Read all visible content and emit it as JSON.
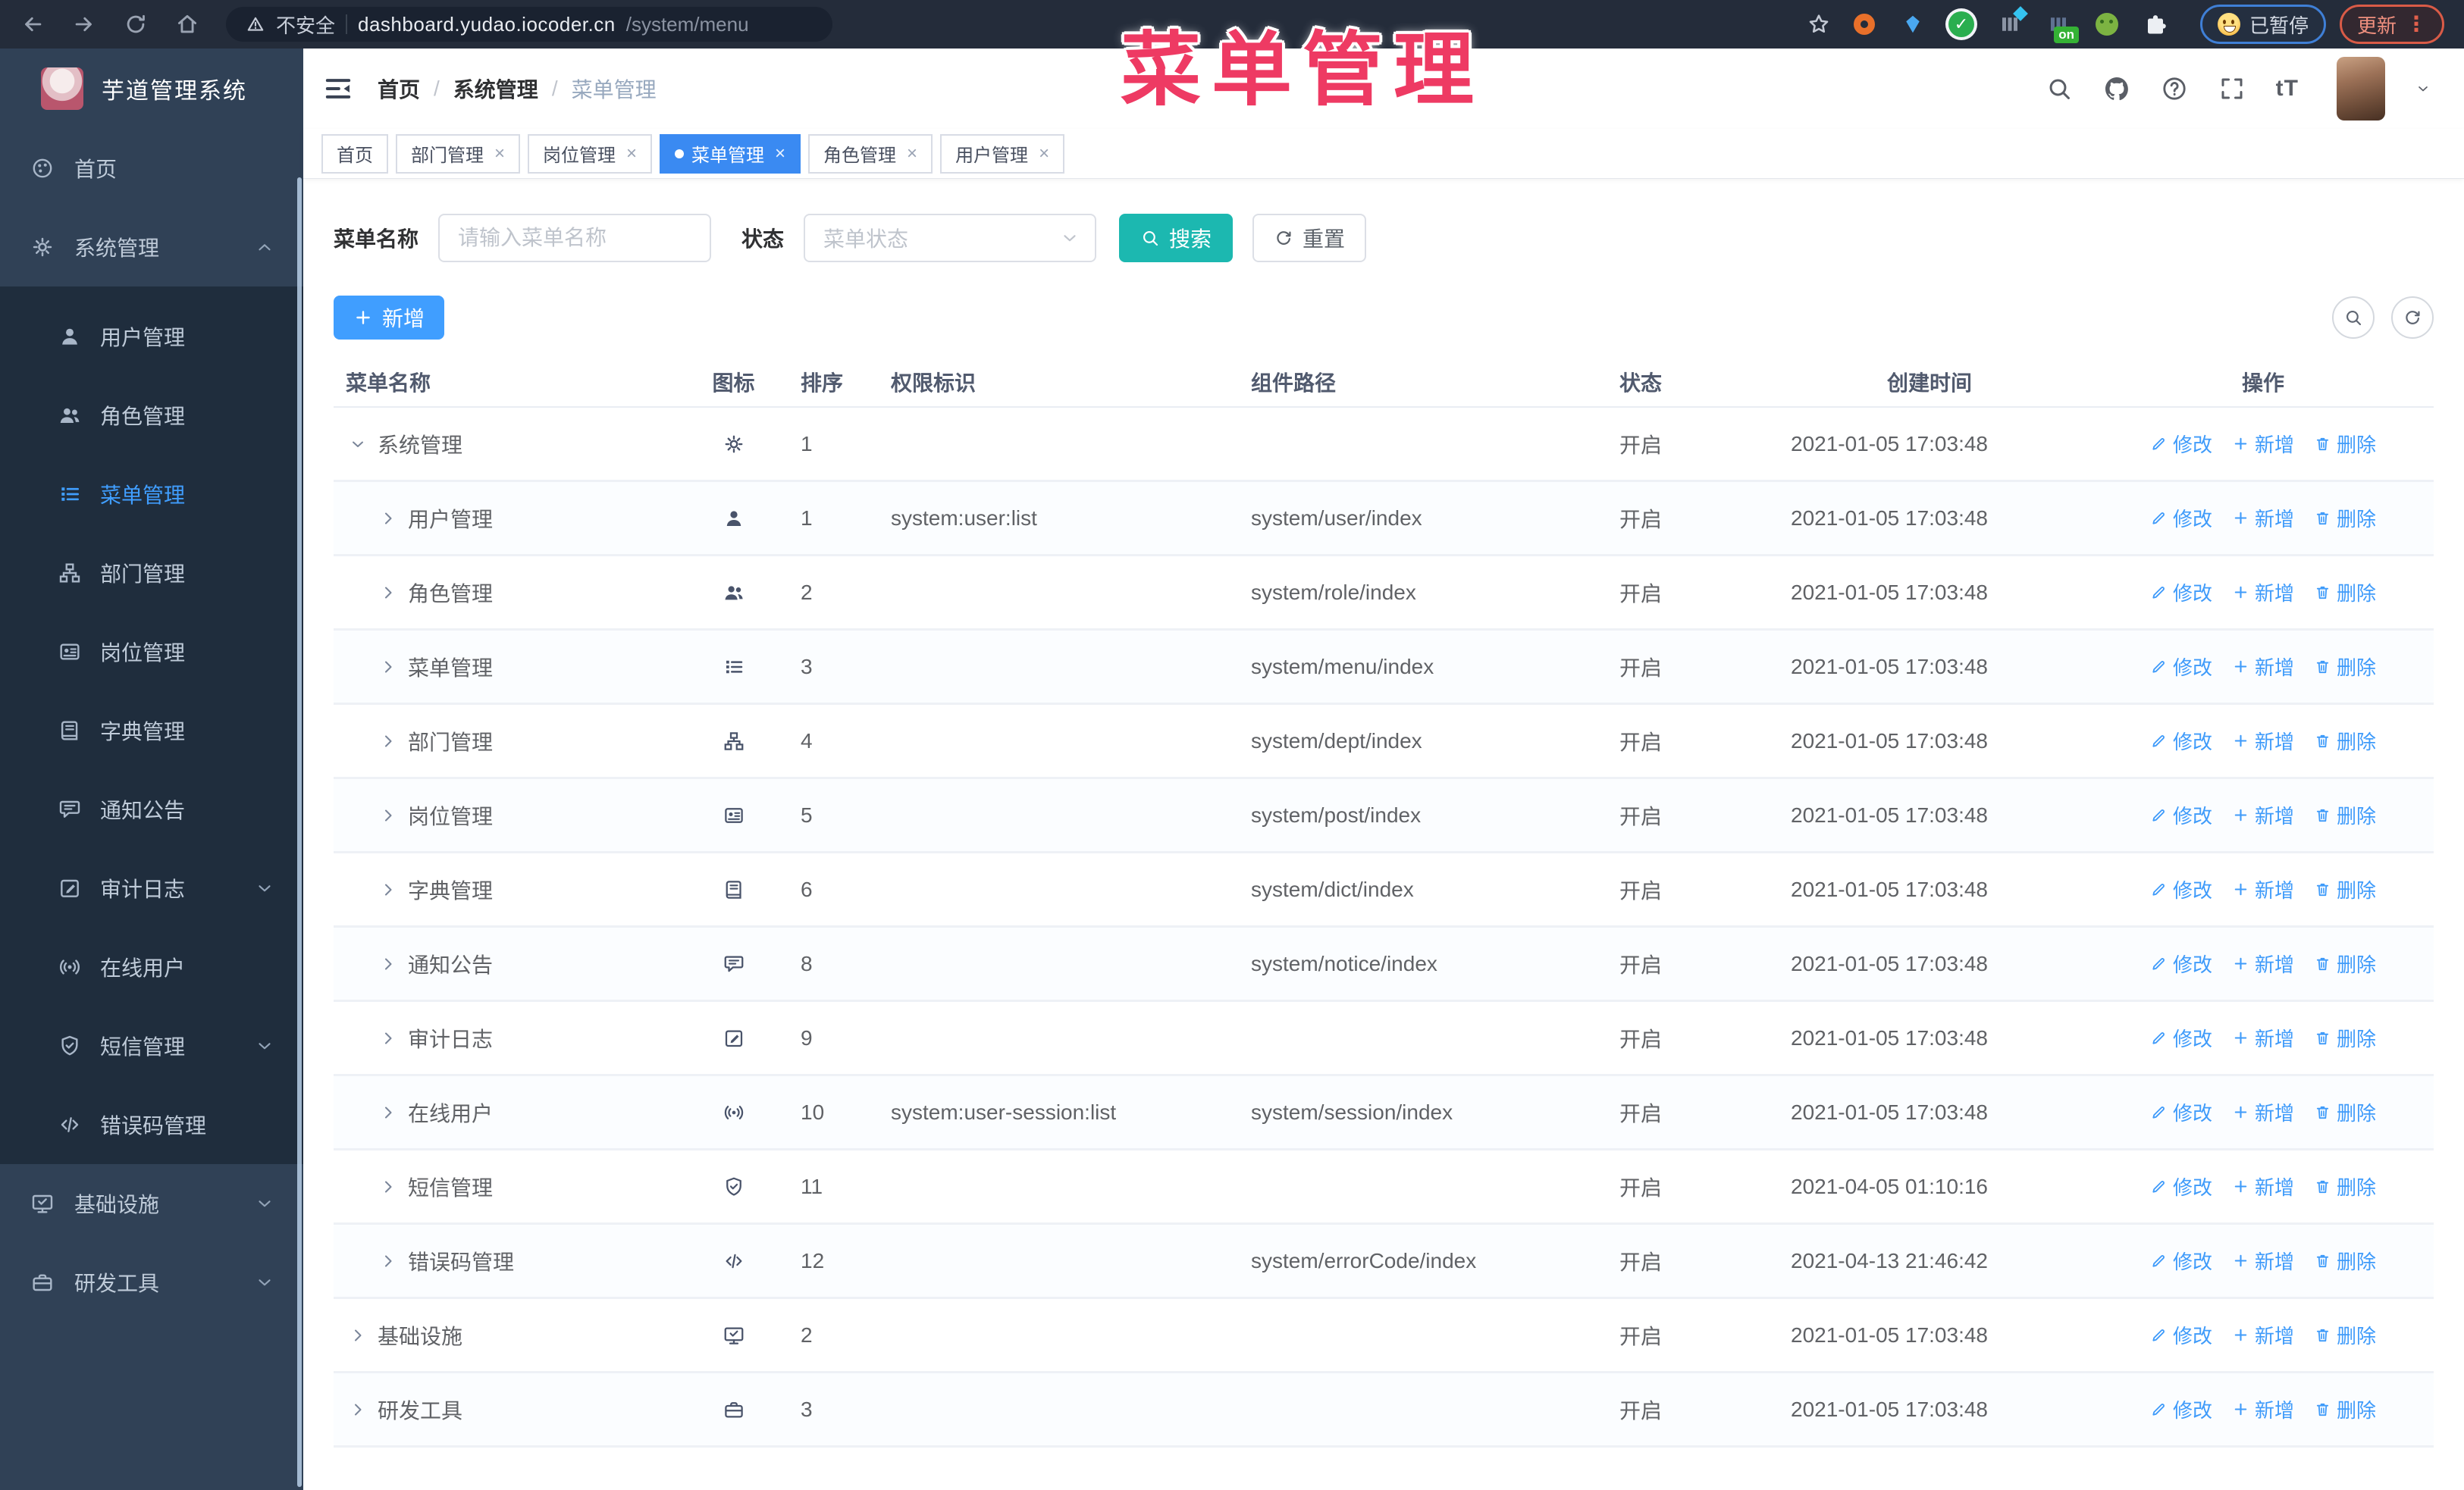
{
  "colors": {
    "accent_blue": "#409EFF",
    "accent_teal": "#1cb8b0",
    "overlay_red": "#ee3a63",
    "sidebar_bg": "#304156",
    "submenu_bg": "#1f2d3d"
  },
  "browser": {
    "security_label": "不安全",
    "url_host": "dashboard.yudao.iocoder.cn",
    "url_path": "/system/menu",
    "ext_on_badge": "on",
    "paused_badge": "已暂停",
    "update_button": "更新"
  },
  "overlay": {
    "title": "菜单管理"
  },
  "app": {
    "logo_title": "芋道管理系统",
    "breadcrumb": [
      "首页",
      "系统管理",
      "菜单管理"
    ],
    "breadcrumb_separator": "/"
  },
  "tabs": [
    {
      "label": "首页",
      "closable": false,
      "active": false
    },
    {
      "label": "部门管理",
      "closable": true,
      "active": false
    },
    {
      "label": "岗位管理",
      "closable": true,
      "active": false
    },
    {
      "label": "菜单管理",
      "closable": true,
      "active": true
    },
    {
      "label": "角色管理",
      "closable": true,
      "active": false
    },
    {
      "label": "用户管理",
      "closable": true,
      "active": false
    }
  ],
  "sidebar": {
    "items": [
      {
        "label": "首页",
        "icon": "dashboard-icon",
        "level": "top"
      },
      {
        "label": "系统管理",
        "icon": "gear-icon",
        "level": "top",
        "expanded": true,
        "caret": "up"
      },
      {
        "label": "用户管理",
        "icon": "user-icon",
        "level": "sub"
      },
      {
        "label": "角色管理",
        "icon": "users-icon",
        "level": "sub"
      },
      {
        "label": "菜单管理",
        "icon": "menu-icon",
        "level": "sub",
        "active": true
      },
      {
        "label": "部门管理",
        "icon": "tree-icon",
        "level": "sub"
      },
      {
        "label": "岗位管理",
        "icon": "post-icon",
        "level": "sub"
      },
      {
        "label": "字典管理",
        "icon": "dict-icon",
        "level": "sub"
      },
      {
        "label": "通知公告",
        "icon": "notice-icon",
        "level": "sub"
      },
      {
        "label": "审计日志",
        "icon": "log-icon",
        "level": "sub",
        "caret": "down"
      },
      {
        "label": "在线用户",
        "icon": "online-icon",
        "level": "sub"
      },
      {
        "label": "短信管理",
        "icon": "sms-icon",
        "level": "sub",
        "caret": "down"
      },
      {
        "label": "错误码管理",
        "icon": "code-icon",
        "level": "sub"
      },
      {
        "label": "基础设施",
        "icon": "infra-icon",
        "level": "top",
        "caret": "down"
      },
      {
        "label": "研发工具",
        "icon": "tool-icon",
        "level": "top",
        "caret": "down"
      }
    ]
  },
  "search": {
    "name_label": "菜单名称",
    "name_placeholder": "请输入菜单名称",
    "status_label": "状态",
    "status_placeholder": "菜单状态",
    "search_button": "搜索",
    "reset_button": "重置"
  },
  "toolbar": {
    "add_button": "新增"
  },
  "table": {
    "headers": [
      "菜单名称",
      "图标",
      "排序",
      "权限标识",
      "组件路径",
      "状态",
      "创建时间",
      "操作"
    ],
    "actions": {
      "edit": "修改",
      "add": "新增",
      "delete": "删除"
    },
    "rows": [
      {
        "name": "系统管理",
        "icon": "gear-icon",
        "sort": "1",
        "perm": "",
        "path": "",
        "status": "开启",
        "time": "2021-01-05 17:03:48",
        "level": 0,
        "expanded": true
      },
      {
        "name": "用户管理",
        "icon": "user-icon",
        "sort": "1",
        "perm": "system:user:list",
        "path": "system/user/index",
        "status": "开启",
        "time": "2021-01-05 17:03:48",
        "level": 1
      },
      {
        "name": "角色管理",
        "icon": "users-icon",
        "sort": "2",
        "perm": "",
        "path": "system/role/index",
        "status": "开启",
        "time": "2021-01-05 17:03:48",
        "level": 1
      },
      {
        "name": "菜单管理",
        "icon": "menu-icon",
        "sort": "3",
        "perm": "",
        "path": "system/menu/index",
        "status": "开启",
        "time": "2021-01-05 17:03:48",
        "level": 1
      },
      {
        "name": "部门管理",
        "icon": "tree-icon",
        "sort": "4",
        "perm": "",
        "path": "system/dept/index",
        "status": "开启",
        "time": "2021-01-05 17:03:48",
        "level": 1
      },
      {
        "name": "岗位管理",
        "icon": "post-icon",
        "sort": "5",
        "perm": "",
        "path": "system/post/index",
        "status": "开启",
        "time": "2021-01-05 17:03:48",
        "level": 1
      },
      {
        "name": "字典管理",
        "icon": "dict-icon",
        "sort": "6",
        "perm": "",
        "path": "system/dict/index",
        "status": "开启",
        "time": "2021-01-05 17:03:48",
        "level": 1
      },
      {
        "name": "通知公告",
        "icon": "notice-icon",
        "sort": "8",
        "perm": "",
        "path": "system/notice/index",
        "status": "开启",
        "time": "2021-01-05 17:03:48",
        "level": 1
      },
      {
        "name": "审计日志",
        "icon": "log-icon",
        "sort": "9",
        "perm": "",
        "path": "",
        "status": "开启",
        "time": "2021-01-05 17:03:48",
        "level": 1
      },
      {
        "name": "在线用户",
        "icon": "online-icon",
        "sort": "10",
        "perm": "system:user-session:list",
        "path": "system/session/index",
        "status": "开启",
        "time": "2021-01-05 17:03:48",
        "level": 1
      },
      {
        "name": "短信管理",
        "icon": "sms-icon",
        "sort": "11",
        "perm": "",
        "path": "",
        "status": "开启",
        "time": "2021-04-05 01:10:16",
        "level": 1
      },
      {
        "name": "错误码管理",
        "icon": "code-icon",
        "sort": "12",
        "perm": "",
        "path": "system/errorCode/index",
        "status": "开启",
        "time": "2021-04-13 21:46:42",
        "level": 1
      },
      {
        "name": "基础设施",
        "icon": "infra-icon",
        "sort": "2",
        "perm": "",
        "path": "",
        "status": "开启",
        "time": "2021-01-05 17:03:48",
        "level": 0
      },
      {
        "name": "研发工具",
        "icon": "tool-icon",
        "sort": "3",
        "perm": "",
        "path": "",
        "status": "开启",
        "time": "2021-01-05 17:03:48",
        "level": 0
      }
    ]
  }
}
